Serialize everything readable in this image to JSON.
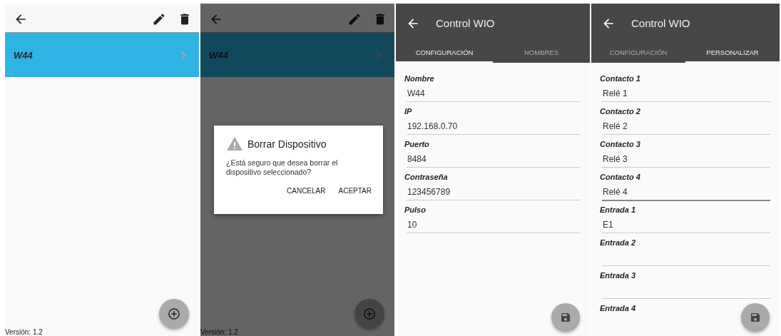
{
  "screens": [
    {
      "kind": "device_list",
      "dimmed": false,
      "devices": [
        {
          "name": "W44",
          "selected": true
        }
      ],
      "version": "Versión: 1.2"
    },
    {
      "kind": "device_list",
      "dimmed": true,
      "devices": [
        {
          "name": "W44",
          "selected": true
        }
      ],
      "version": "Versión: 1.2",
      "dialog": {
        "title": "Borrar Dispositivo",
        "message": "¿Está seguro que desea borrar el dispositivo seleccionado?",
        "buttons": [
          "CANCELAR",
          "ACEPTAR"
        ]
      }
    },
    {
      "kind": "form",
      "title": "Control WIO",
      "tabs": [
        {
          "label": "CONFIGURACIÓN",
          "selected": true
        },
        {
          "label": "NOMBRES",
          "selected": false
        }
      ],
      "fields": [
        {
          "kind": "text",
          "label": "Nombre",
          "value": "W44",
          "focused": false
        },
        {
          "kind": "text",
          "label": "IP",
          "value": "192.168.0.70",
          "focused": false
        },
        {
          "kind": "text",
          "label": "Puerto",
          "value": "8484",
          "focused": false
        },
        {
          "kind": "text",
          "label": "Contraseña",
          "value": "123456789",
          "focused": false
        },
        {
          "kind": "text",
          "label": "Pulso",
          "value": "10",
          "focused": false
        }
      ]
    },
    {
      "kind": "form",
      "title": "Control WIO",
      "tabs": [
        {
          "label": "CONFIGURACIÓN",
          "selected": false
        },
        {
          "label": "PERSONALIZAR",
          "selected": true
        }
      ],
      "fields": [
        {
          "kind": "text",
          "label": "Contacto 1",
          "value": "Relé 1",
          "focused": false
        },
        {
          "kind": "text",
          "label": "Contacto 2",
          "value": "Relé 2",
          "focused": false
        },
        {
          "kind": "text",
          "label": "Contacto 3",
          "value": "Relé 3",
          "focused": false
        },
        {
          "kind": "text",
          "label": "Contacto 4",
          "value": "Relé 4",
          "focused": true
        },
        {
          "kind": "text",
          "label": "Entrada 1",
          "value": "E1",
          "focused": false
        },
        {
          "kind": "text",
          "label": "Entrada 2",
          "focused": false
        },
        {
          "kind": "text",
          "label": "Entrada 3",
          "focused": false
        },
        {
          "kind": "label_only",
          "label": "Entrada 4"
        }
      ]
    }
  ]
}
